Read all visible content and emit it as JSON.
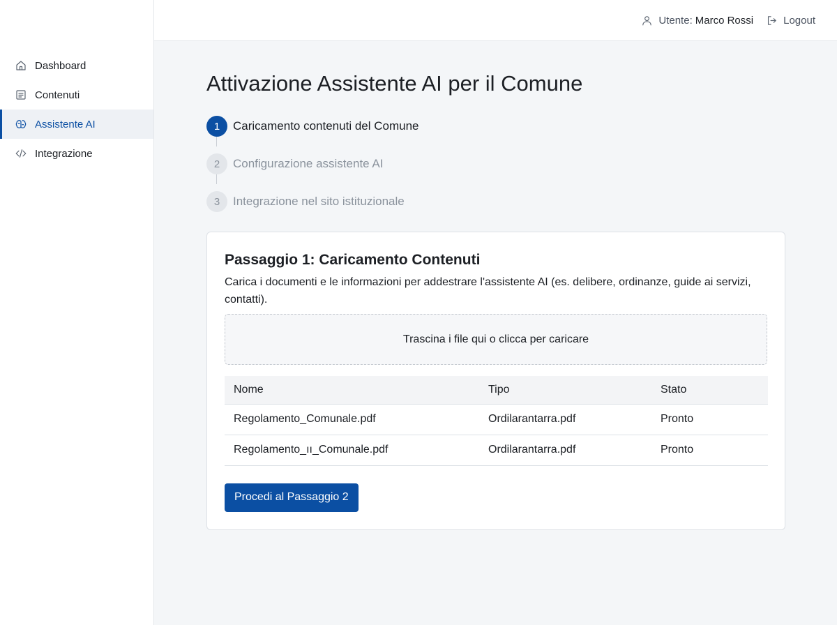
{
  "sidebar": {
    "items": [
      {
        "label": "Dashboard",
        "icon": "home-icon"
      },
      {
        "label": "Contenuti",
        "icon": "document-icon"
      },
      {
        "label": "Assistente AI",
        "icon": "brain-icon",
        "active": true
      },
      {
        "label": "Integrazione",
        "icon": "code-icon"
      }
    ]
  },
  "header": {
    "user_prefix": "Utente:",
    "user_name": "Marco Rossi",
    "logout_label": "Logout"
  },
  "main": {
    "title": "Attivazione Assistente AI per il Comune",
    "steps": [
      {
        "number": "1",
        "label": "Caricamento contenuti del Comune",
        "active": true
      },
      {
        "number": "2",
        "label": "Configurazione assistente AI",
        "active": false
      },
      {
        "number": "3",
        "label": "Integrazione nel sito istituzionale",
        "active": false
      }
    ],
    "card": {
      "title": "Passaggio 1: Caricamento Contenuti",
      "description": "Carica i documenti e le informazioni per addestrare l'assistente AI (es. delibere, ordinanze, guide ai servizi, contatti).",
      "dropzone_label": "Trascina i file qui o clicca per caricare",
      "table": {
        "headers": [
          "Nome",
          "Tipo",
          "Stato"
        ],
        "rows": [
          [
            "Regolamento_Comunale.pdf",
            "Ordilarantarra.pdf",
            "Pronto"
          ],
          [
            "Regolamento_ıı_Comunale.pdf",
            "Ordilarantarra.pdf",
            "Pronto"
          ]
        ]
      },
      "proceed_label": "Procedi al Passaggio 2"
    }
  },
  "colors": {
    "accent": "#0b4fa3",
    "step_inactive": "#e3e6ea",
    "background": "#f4f6f8"
  }
}
